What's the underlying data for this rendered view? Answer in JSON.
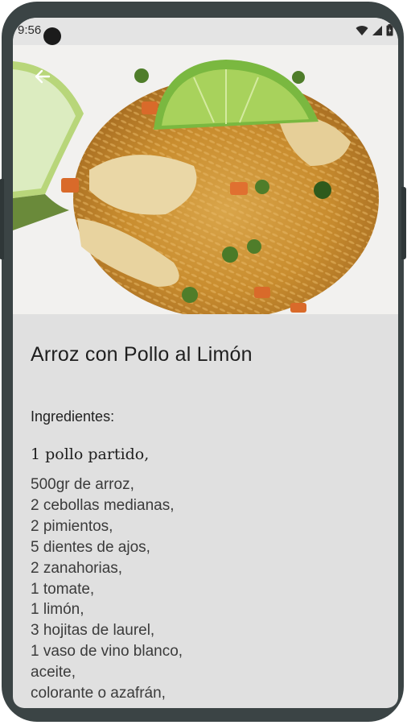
{
  "status_bar": {
    "time": "9:56",
    "icons": [
      "wifi-icon",
      "signal-icon",
      "battery-icon"
    ]
  },
  "toolbar": {
    "back_icon": "arrow-left-icon"
  },
  "hero": {
    "image": "rice-with-chicken-and-lime-photo"
  },
  "recipe": {
    "title": "Arroz con Pollo al Limón",
    "ingredients_label": "Ingredientes:",
    "first_ingredient": "1 pollo partido,",
    "ingredients": [
      "500gr de arroz,",
      "2 cebollas medianas,",
      "2 pimientos,",
      "5 dientes de ajos,",
      "2 zanahorias,",
      "1 tomate,",
      "1 limón,",
      "3 hojitas de laurel,",
      "1 vaso de vino blanco,",
      "aceite,",
      "colorante o azafrán,"
    ]
  },
  "colors": {
    "frame": "#3b4445",
    "screen_bg": "#e0e0e0",
    "text": "#1f1f1f"
  }
}
